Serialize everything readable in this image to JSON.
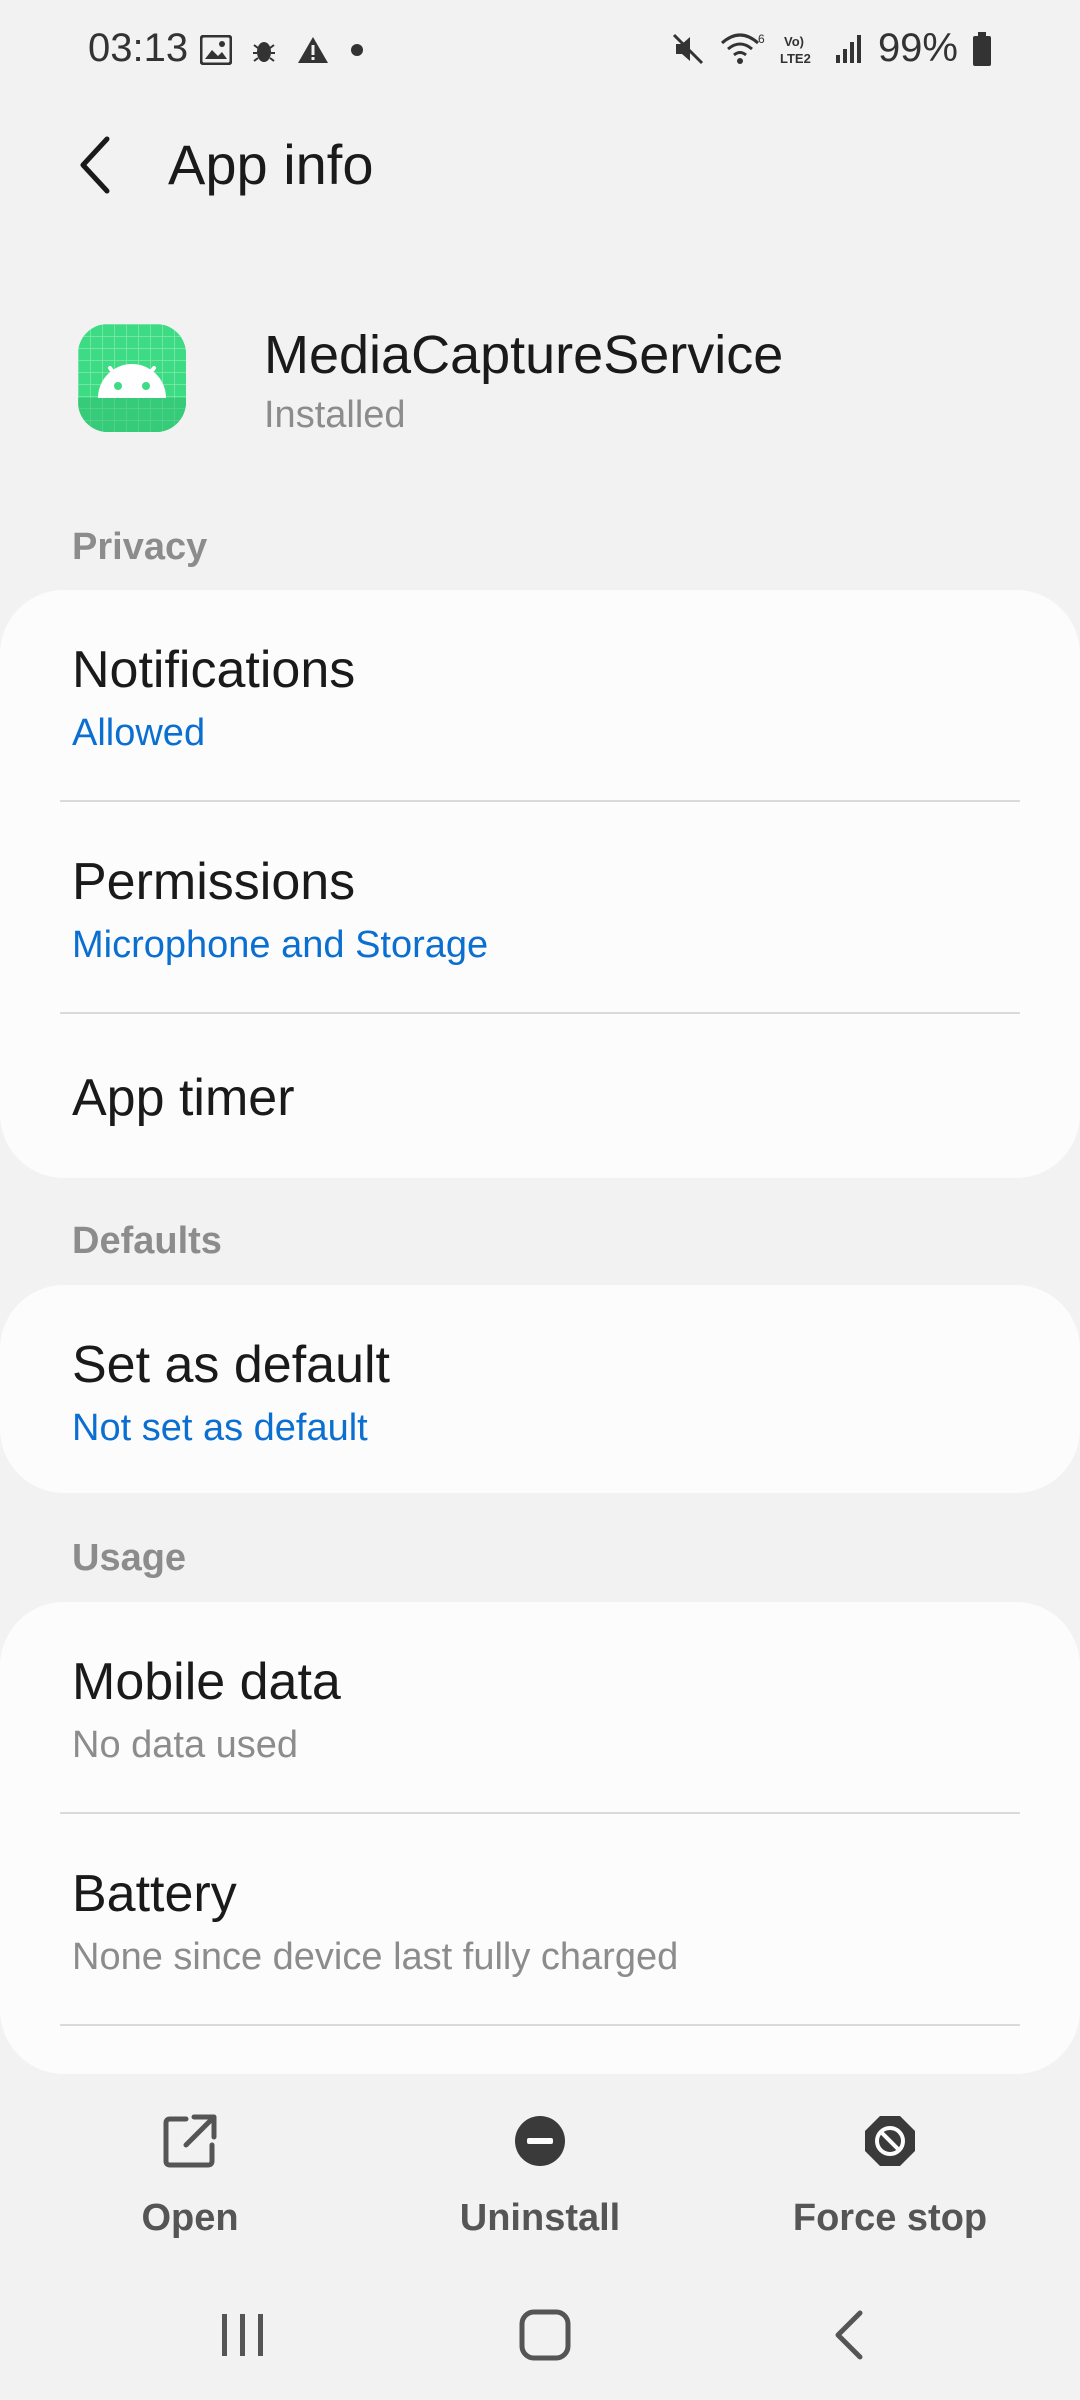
{
  "status_bar": {
    "time": "03:13",
    "battery_percent": "99%",
    "left_icons": [
      "image-icon",
      "bug-icon",
      "warning-icon",
      "dot-icon"
    ],
    "right_icons": [
      "mute-icon",
      "wifi-6-icon",
      "volte-lte2-icon",
      "signal-icon",
      "battery-icon"
    ]
  },
  "header": {
    "title": "App info"
  },
  "app": {
    "name": "MediaCaptureService",
    "status": "Installed",
    "icon": "android-icon",
    "icon_color": "#3ddc84"
  },
  "sections": {
    "privacy": {
      "label": "Privacy",
      "items": [
        {
          "title": "Notifications",
          "subtitle": "Allowed"
        },
        {
          "title": "Permissions",
          "subtitle": "Microphone and Storage"
        },
        {
          "title": "App timer"
        }
      ]
    },
    "defaults": {
      "label": "Defaults",
      "items": [
        {
          "title": "Set as default",
          "subtitle": "Not set as default"
        }
      ]
    },
    "usage": {
      "label": "Usage",
      "items": [
        {
          "title": "Mobile data",
          "subtitle": "No data used"
        },
        {
          "title": "Battery",
          "subtitle": "None since device last fully charged"
        }
      ]
    }
  },
  "actions": [
    {
      "label": "Open",
      "icon": "open-external-icon"
    },
    {
      "label": "Uninstall",
      "icon": "uninstall-icon"
    },
    {
      "label": "Force stop",
      "icon": "force-stop-icon"
    }
  ],
  "colors": {
    "accent_blue": "#0a6fd1",
    "background": "#f2f2f2",
    "card": "#fcfcfc"
  }
}
